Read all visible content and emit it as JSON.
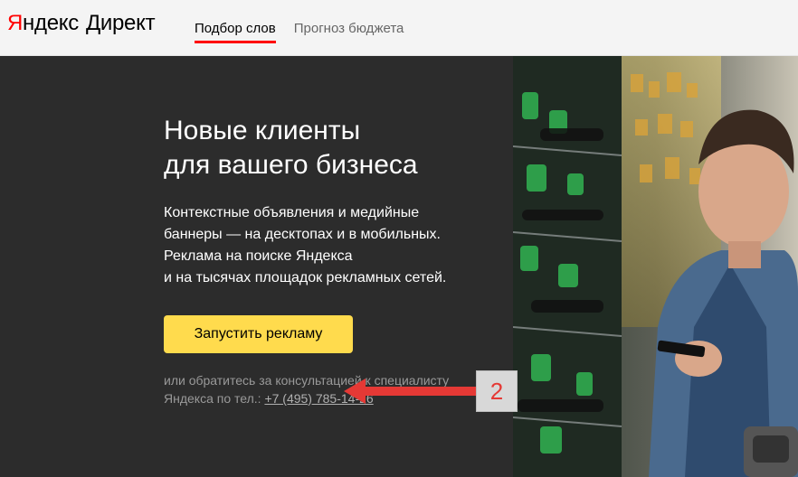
{
  "header": {
    "logo_y": "Я",
    "logo_rest": "ндекс",
    "logo_direct": "Директ",
    "tabs": [
      {
        "label": "Подбор слов",
        "active": true
      },
      {
        "label": "Прогноз бюджета",
        "active": false
      }
    ]
  },
  "hero": {
    "title_lines": [
      "Новые клиенты",
      "для вашего бизнеса"
    ],
    "description_lines": [
      "Контекстные объявления и медийные",
      "баннеры — на десктопах и в мобильных.",
      "Реклама на поиске Яндекса",
      "и на тысячах площадок рекламных сетей."
    ],
    "cta_label": "Запустить рекламу",
    "contact_line1": "или обратитесь за консультацией к специалисту",
    "contact_line2_prefix": "Яндекса по тел.: ",
    "contact_phone": "+7 (495) 785-14-26"
  },
  "annotation": {
    "badge_number": "2",
    "arrow_color": "#e53935"
  },
  "colors": {
    "brand_red": "#ff0000",
    "cta_yellow": "#ffdb4d",
    "hero_bg": "#2c2c2c"
  }
}
